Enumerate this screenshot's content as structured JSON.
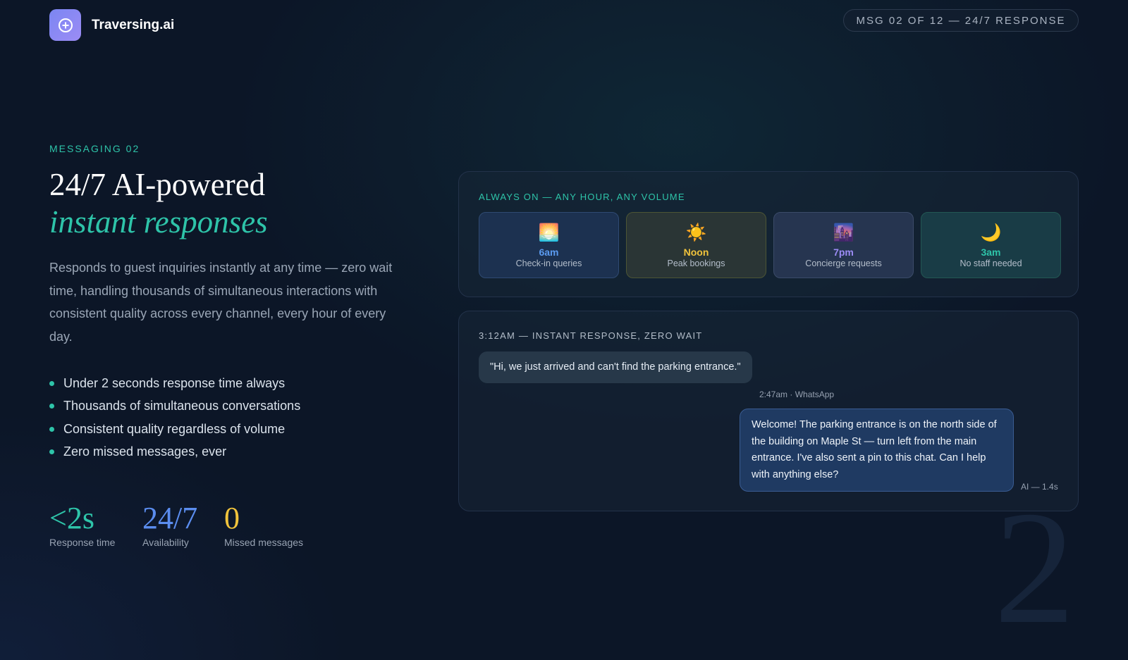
{
  "brand": {
    "name": "Traversing.ai",
    "logo_icon": "plus-circle-icon"
  },
  "header": {
    "progress_pill": "MSG 02 OF 12 — 24/7 RESPONSE"
  },
  "hero": {
    "eyebrow": "MESSAGING 02",
    "title_line1": "24/7 AI-powered",
    "title_line2": "instant responses",
    "description": "Responds to guest inquiries instantly at any time — zero wait time, handling thousands of simultaneous interactions with consistent quality across every channel, every hour of every day.",
    "bullets": [
      "Under 2 seconds response time always",
      "Thousands of simultaneous conversations",
      "Consistent quality regardless of volume",
      "Zero missed messages, ever"
    ]
  },
  "stats": [
    {
      "value": "<2s",
      "label": "Response time",
      "color": "#2ec4a9"
    },
    {
      "value": "24/7",
      "label": "Availability",
      "color": "#5b8def"
    },
    {
      "value": "0",
      "label": "Missed messages",
      "color": "#f0c33c"
    }
  ],
  "always_on": {
    "title": "ALWAYS ON — ANY HOUR, ANY VOLUME",
    "tiles": [
      {
        "icon": "sunrise-icon",
        "emoji": "🌅",
        "time": "6am",
        "label": "Check-in queries"
      },
      {
        "icon": "sun-icon",
        "emoji": "☀️",
        "time": "Noon",
        "label": "Peak bookings"
      },
      {
        "icon": "city-dusk-icon",
        "emoji": "🌆",
        "time": "7pm",
        "label": "Concierge requests"
      },
      {
        "icon": "moon-icon",
        "emoji": "🌙",
        "time": "3am",
        "label": "No staff needed"
      }
    ]
  },
  "conversation": {
    "title": "3:12AM — INSTANT RESPONSE, ZERO WAIT",
    "guest_message": "\"Hi, we just arrived and can't find the parking entrance.\"",
    "guest_meta": "2:47am · WhatsApp",
    "ai_message": "Welcome! The parking entrance is on the north side of the building on Maple St — turn left from the main entrance. I've also sent a pin to this chat. Can I help with anything else?",
    "ai_meta": "AI — 1.4s"
  },
  "slide_number": "2"
}
